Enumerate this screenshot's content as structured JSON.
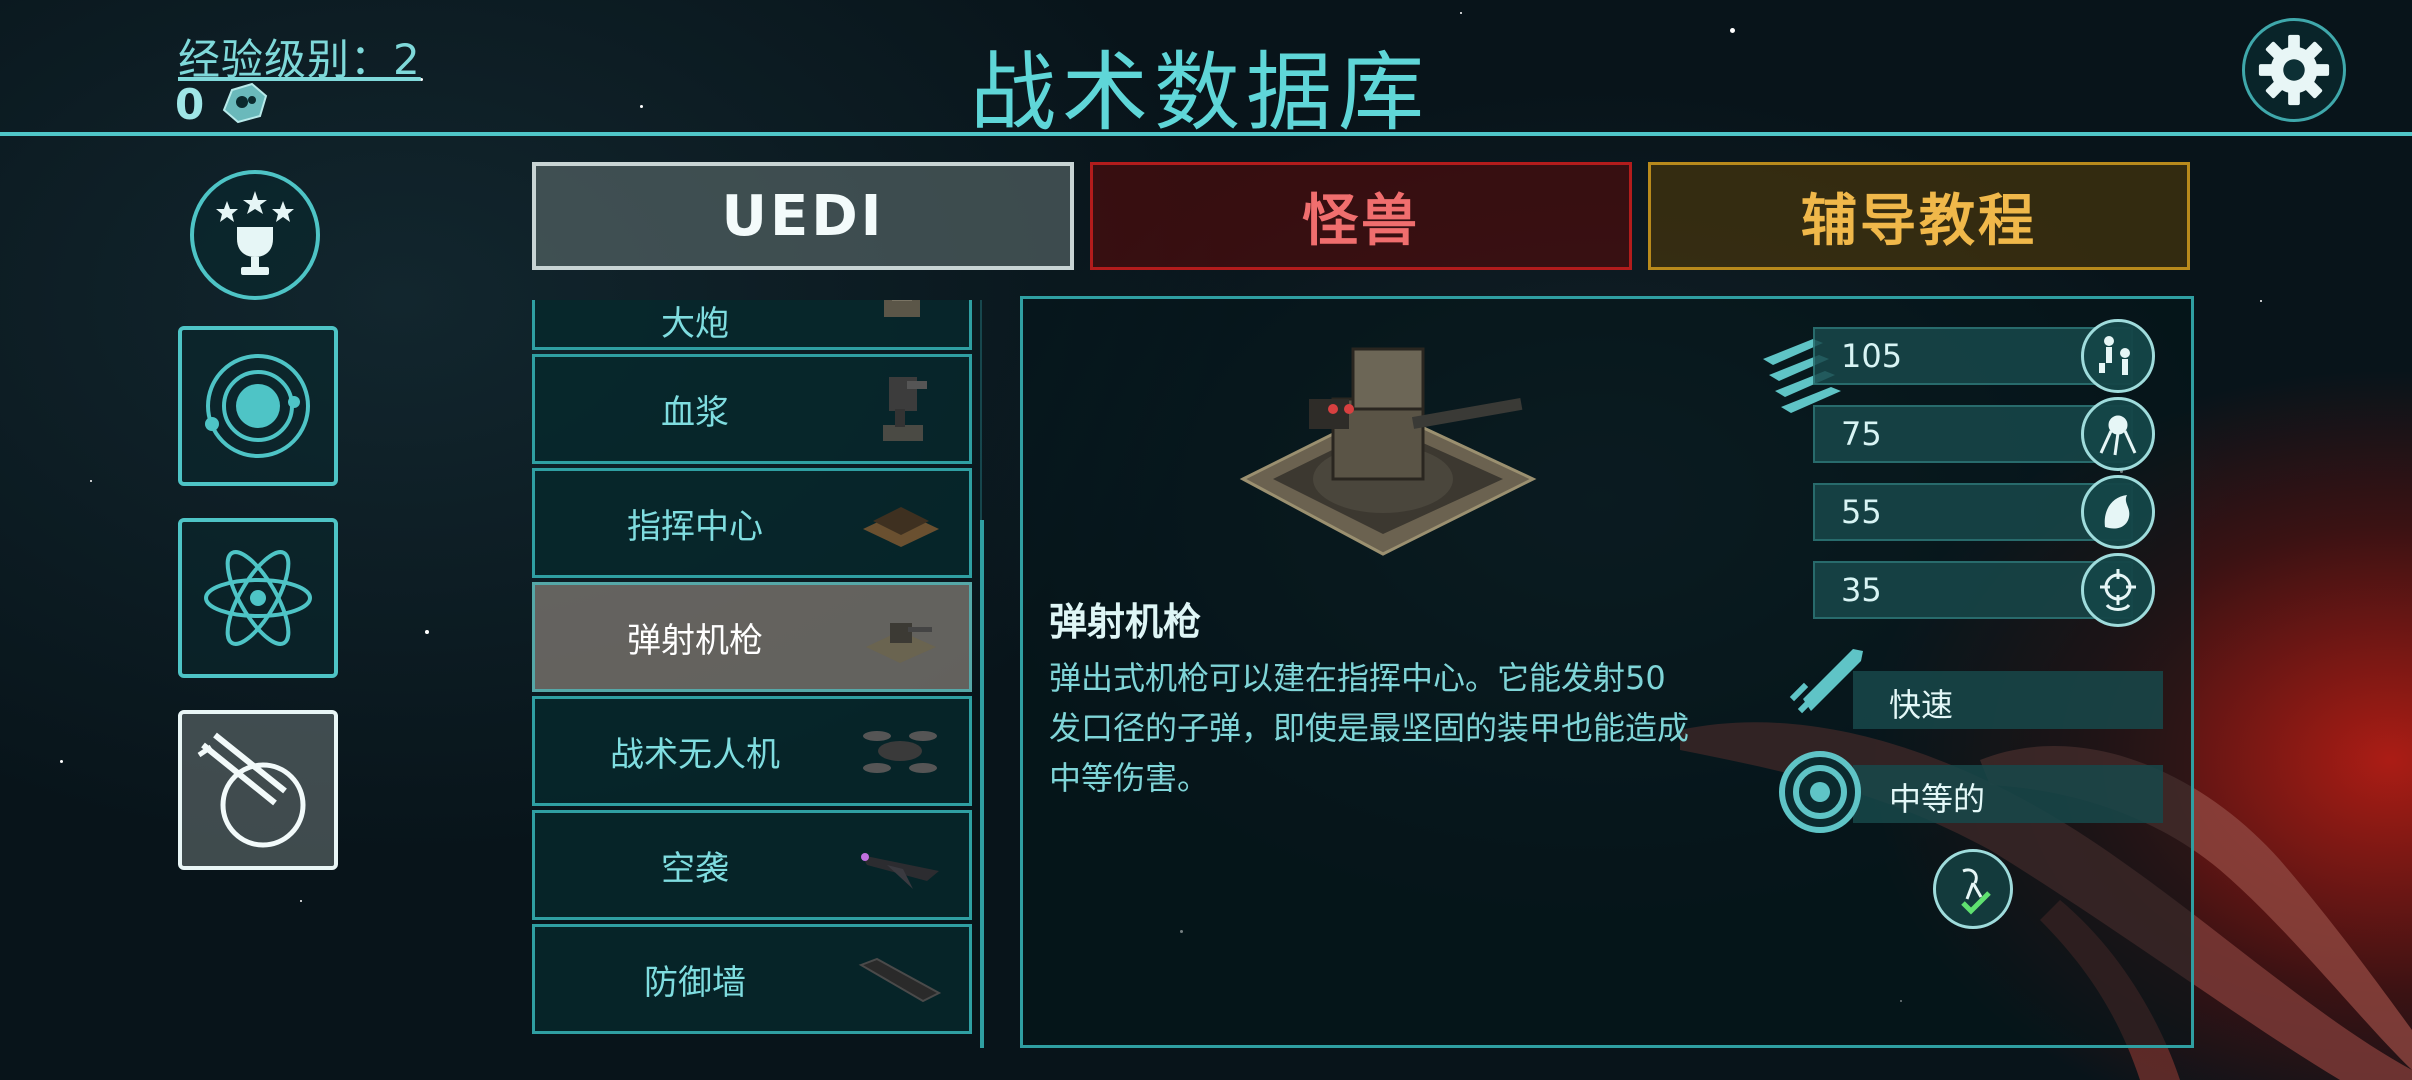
{
  "header": {
    "xp_label": "经验级别：2",
    "xp_points": "0",
    "title": "战术数据库",
    "settings_icon": "gear-icon"
  },
  "nav": [
    {
      "name": "trophy",
      "icon": "trophy-icon"
    },
    {
      "name": "planet",
      "icon": "planet-orbit-icon"
    },
    {
      "name": "atom",
      "icon": "atom-icon"
    },
    {
      "name": "weapons",
      "icon": "crossed-blades-icon",
      "active": true
    }
  ],
  "tabs": [
    {
      "label": "UEDI",
      "color": "#c8d4d4",
      "active": true
    },
    {
      "label": "怪兽",
      "color": "#f06e6e"
    },
    {
      "label": "辅导教程",
      "color": "#f0b84a"
    }
  ],
  "list": {
    "partial_top": "大炮",
    "items": [
      "血浆",
      "指挥中心",
      "弹射机枪",
      "战术无人机",
      "空袭",
      "防御墙"
    ],
    "selected": "弹射机枪"
  },
  "detail": {
    "name": "弹射机枪",
    "description": "弹出式机枪可以建在指挥中心。它能发射50发口径的子弹，即使是最坚固的装甲也能造成中等伤害。",
    "stats": [
      {
        "value": "105",
        "icon": "infantry-icon"
      },
      {
        "value": "75",
        "icon": "spider-monster-icon"
      },
      {
        "value": "55",
        "icon": "beast-icon"
      },
      {
        "value": "35",
        "icon": "crosshair-monster-icon"
      }
    ],
    "speed": "快速",
    "range": "中等的",
    "target_icon": "air-target-check-icon"
  }
}
